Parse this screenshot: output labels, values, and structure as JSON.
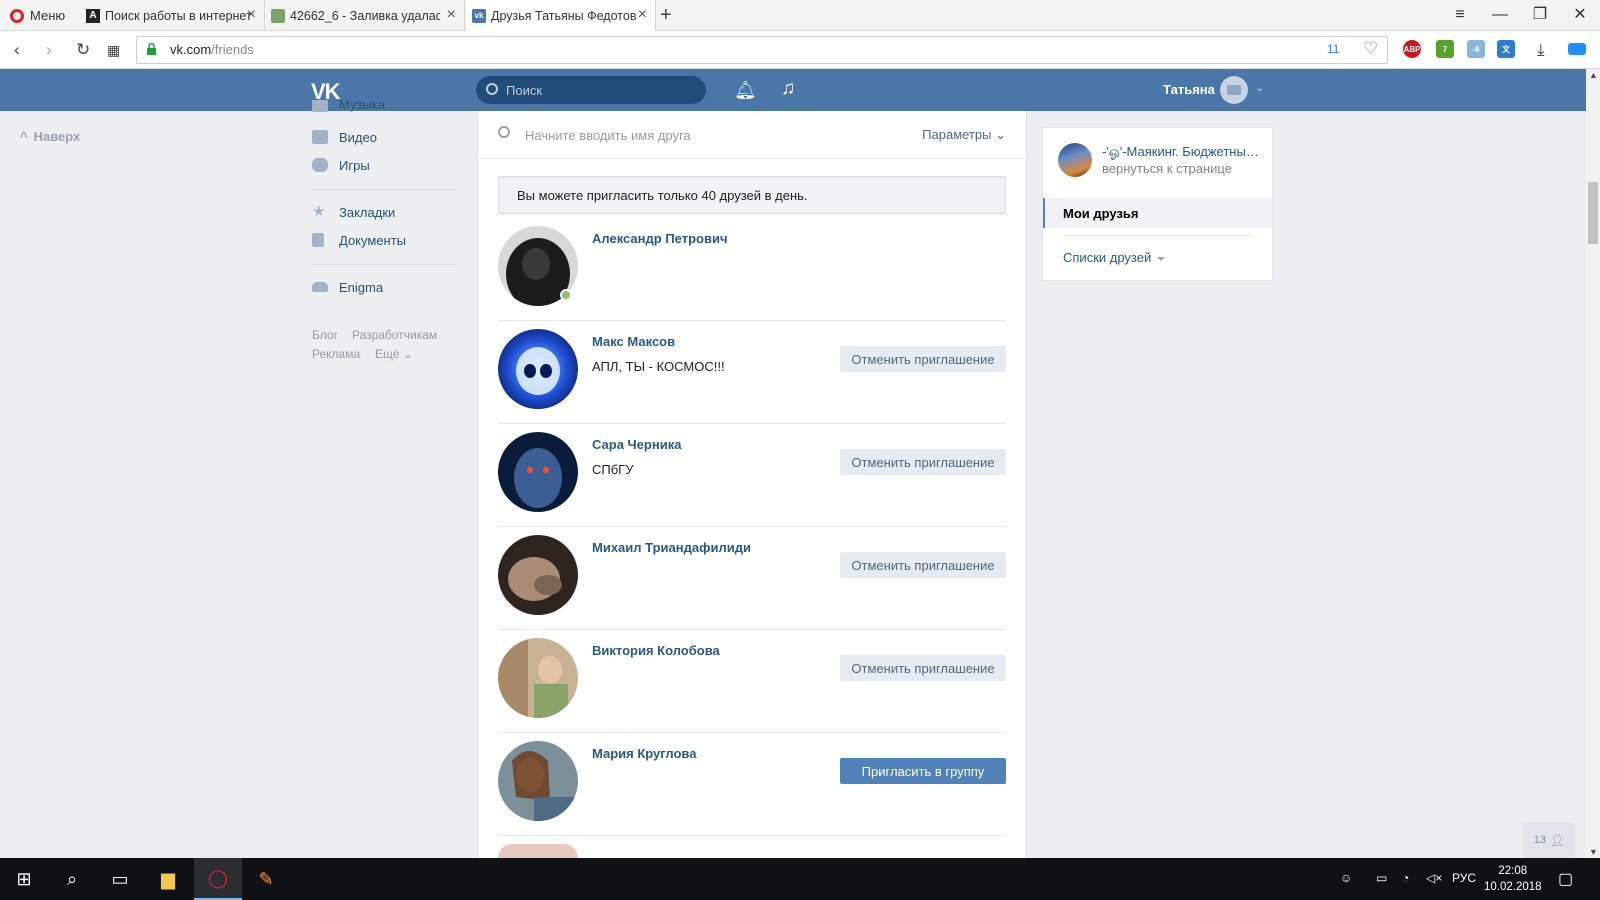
{
  "browser": {
    "menu_label": "Меню",
    "tabs": [
      {
        "title": "Поиск работы в интернет",
        "favicon": "А"
      },
      {
        "title": "42662_6 - Заливка удалас",
        "favicon": ""
      },
      {
        "title": "Друзья Татьяны Федотов",
        "favicon": "vk"
      }
    ],
    "url_host": "vk.com",
    "url_path": "/friends",
    "adblock_count": "11",
    "extensions": {
      "abp": "ABP",
      "badge1": "7",
      "badge2": "-6"
    }
  },
  "vk": {
    "search_placeholder": "Поиск",
    "user_name": "Татьяна"
  },
  "left": {
    "to_top": "Наверх",
    "menu": [
      {
        "label": "Музыка",
        "icon": "music-icon"
      },
      {
        "label": "Видео",
        "icon": "video-icon"
      },
      {
        "label": "Игры",
        "icon": "games-icon"
      },
      {
        "label": "Закладки",
        "icon": "star-icon"
      },
      {
        "label": "Документы",
        "icon": "document-icon"
      },
      {
        "label": "Enigma",
        "icon": "group-icon"
      }
    ],
    "footer": [
      "Блог",
      "Разработчикам",
      "Реклама",
      "Ещё"
    ]
  },
  "main": {
    "search_placeholder": "Начните вводить имя друга",
    "params_label": "Параметры",
    "notice": "Вы можете пригласить только 40 друзей в день.",
    "friends": [
      {
        "name": "Александр Петрович",
        "status": "",
        "online": true,
        "button": "",
        "color": "#2a2a2a"
      },
      {
        "name": "Макс Максов",
        "status": "АПЛ, ТЫ - КОСМОС!!!",
        "online": false,
        "button": "Отменить приглашение",
        "color": "#1f4fd6"
      },
      {
        "name": "Сара Черника",
        "status": "СПбГУ",
        "online": false,
        "button": "Отменить приглашение",
        "color": "#1a3a6b"
      },
      {
        "name": "Михаил Триандафилиди",
        "status": "",
        "online": false,
        "button": "Отменить приглашение",
        "color": "#7a6555"
      },
      {
        "name": "Виктория Колобова",
        "status": "",
        "online": false,
        "button": "Отменить приглашение",
        "color": "#b49a78"
      },
      {
        "name": "Мария Круглова",
        "status": "",
        "online": false,
        "button": "Пригласить в группу",
        "color": "#6c7f8c"
      }
    ]
  },
  "right": {
    "group_name": "-'ஓ'-Маякинг. Бюджетный",
    "back_label": "вернуться к странице",
    "my_friends": "Мои друзья",
    "friend_lists": "Списки друзей"
  },
  "corner_counter": "13",
  "taskbar": {
    "lang": "РУС",
    "time": "22:08",
    "date": "10.02.2018"
  }
}
